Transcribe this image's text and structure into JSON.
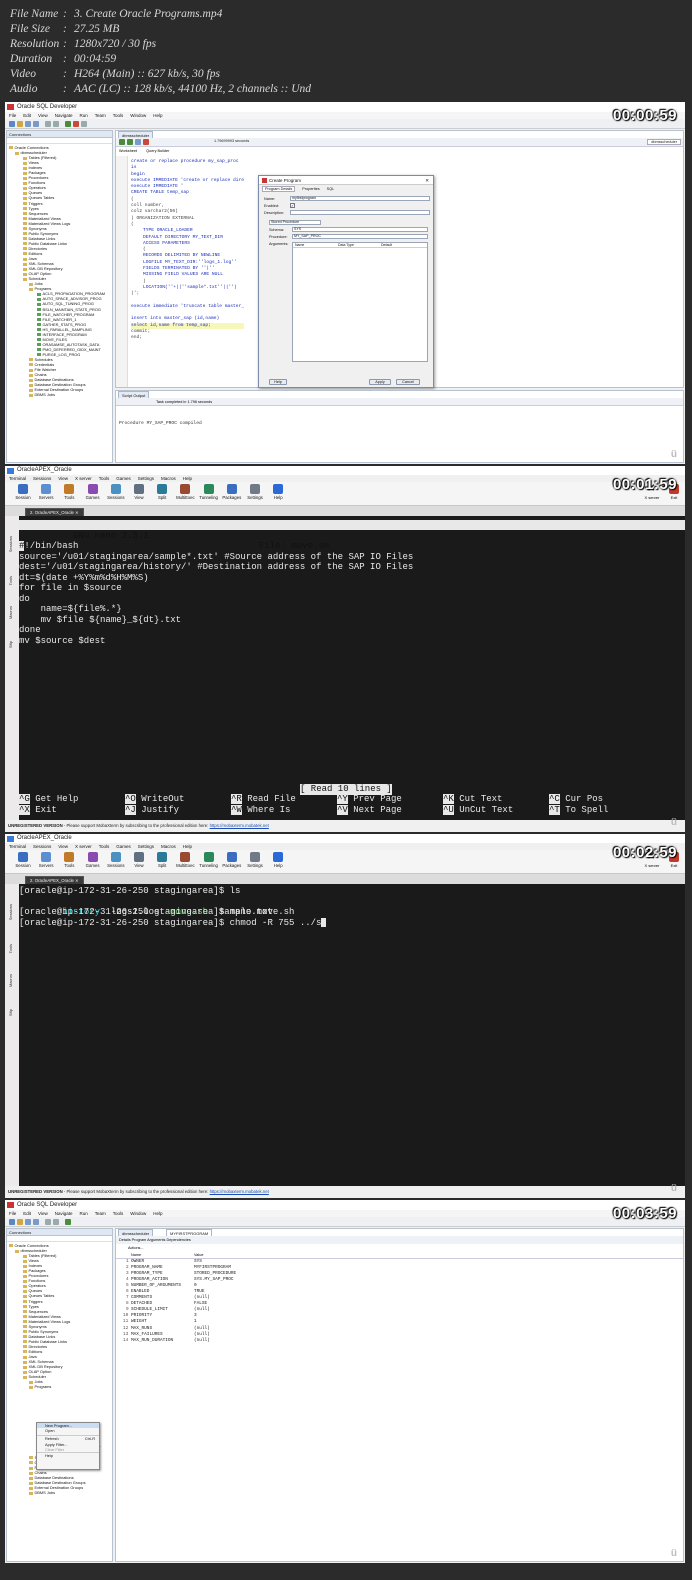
{
  "file_info": [
    {
      "key": "File Name",
      "value": "3. Create Oracle Programs.mp4"
    },
    {
      "key": "File Size",
      "value": "27.25 MB"
    },
    {
      "key": "Resolution",
      "value": "1280x720 / 30 fps"
    },
    {
      "key": "Duration",
      "value": "00:04:59"
    },
    {
      "key": "Video",
      "value": "H264 (Main) :: 627 kb/s, 30 fps"
    },
    {
      "key": "Audio",
      "value": "AAC (LC) :: 128 kb/s, 44100 Hz, 2 channels :: Und"
    }
  ],
  "frame1": {
    "timestamp": "00:00:59",
    "window_title": "Oracle SQL Developer",
    "menu": [
      "File",
      "Edit",
      "View",
      "Navigate",
      "Run",
      "Team",
      "Tools",
      "Window",
      "Help"
    ],
    "connections_title": "Connections",
    "editor_tab": "dbmsscheduler",
    "sub_tabs": [
      "Worksheet",
      "Query Builder"
    ],
    "exec_time": "1.79699993 seconds",
    "connection_select": "dbmsscheduler",
    "tree": [
      "Oracle Connections",
      "dbmsscheduler",
      "Tables (Filtered)",
      "Views",
      "Indexes",
      "Packages",
      "Procedures",
      "Functions",
      "Operators",
      "Queues",
      "Queues Tables",
      "Triggers",
      "Types",
      "Sequences",
      "Materialized Views",
      "Materialized Views Logs",
      "Synonyms",
      "Public Synonyms",
      "Database Links",
      "Public Database Links",
      "Directories",
      "Editions",
      "Java",
      "XML Schemas",
      "XML DB Repository",
      "OLAP Option",
      "Scheduler",
      "Jobs",
      "Programs",
      "ACLS_PROPAGATION_PROGRAM",
      "AUTO_SPACE_ADVISOR_PROG",
      "AUTO_SQL_TUNING_PROG",
      "BSLN_MAINTAIN_STATS_PROG",
      "FILE_WATCHER_PROGRAM",
      "FILE_WATCHER_1",
      "GATHER_STATS_PROG",
      "HS_PARALLEL_SAMPLING",
      "INTERFACE_PROGRAM",
      "MOVE_FILES",
      "ORASAMSE_AUTOTASK_DATA",
      "PMO_DEFERRED_GIDX_MAINT",
      "PURGE_LOG_PROG",
      "Schedules",
      "Credentials",
      "File Watcher",
      "Chains",
      "Database Destinations",
      "Database Destination Groups",
      "External Destination Groups",
      "DBMS Jobs"
    ],
    "code_lines": [
      "create or replace procedure my_sap_proc",
      "is",
      "begin",
      "execute IMMEDIATE 'create or replace dire",
      "execute IMMEDIATE '",
      "CREATE TABLE temp_sap",
      "(",
      "coll number,",
      "col2 varchar2(50)",
      ") ORGANIZATION EXTERNAL",
      "(",
      "TYPE ORACLE_LOADER",
      "DEFAULT DIRECTORY MY_TEXT_DIR",
      "ACCESS PARAMETERS",
      "(",
      "RECORDS DELIMITED BY NEWLINE",
      "LOGFILE MY_TEXT_DIR:''logs_1.log''",
      "FIELDS TERMINATED BY ''|''",
      "MISSING FIELD VALUES ARE NULL",
      ")",
      "LOCATION(''+||''sample*.txt''||'')",
      ")';",
      "",
      "execute immediate 'truncate table master_",
      "",
      "insert into master_sap (id,name)",
      "select id,name from temp_sap;",
      "commit;",
      "end;"
    ],
    "dialog": {
      "title": "Create Program",
      "tabs": [
        "Program Details",
        "Properties",
        "SQL"
      ],
      "name_label": "Name:",
      "name_value": "myfirstprogram",
      "enabled_label": "Enabled:",
      "description_label": "Description:",
      "type_value": "Stored Procedure",
      "schema_label": "Schema:",
      "schema_value": "SYS",
      "procedure_label": "Procedure:",
      "procedure_value": "MY_SAP_PROC",
      "arguments_label": "Arguments:",
      "arg_cols": [
        "Name",
        "Data Type",
        "Default"
      ],
      "help_button": "Help",
      "apply_button": "Apply",
      "cancel_button": "Cancel"
    },
    "output_tab": "Script Output",
    "output_status": "Task completed in 1.796 seconds",
    "output_text": "Procedure MY_SAP_PROC compiled"
  },
  "frame2": {
    "timestamp": "00:01:59",
    "window_title": "OracleAPEX_Oracle",
    "menu": [
      "Terminal",
      "Sessions",
      "View",
      "X server",
      "Tools",
      "Games",
      "Settings",
      "Macros",
      "Help"
    ],
    "toolbar": [
      "Session",
      "Servers",
      "Tools",
      "Games",
      "Sessions",
      "View",
      "Split",
      "MultiExec",
      "Tunneling",
      "Packages",
      "Settings",
      "Help"
    ],
    "xserver_label": "X server",
    "exit_label": "Exit",
    "tab_label": "2. OracleAPEX_Oracle",
    "side_labels": [
      "Sessions",
      "Tools",
      "Macros",
      "Sftp"
    ],
    "nano_version": "  GNU nano 2.3.1",
    "nano_file": "File: move.sh",
    "lines": [
      "#!/bin/bash",
      "source='/u01/stagingarea/sample*.txt' #Source address of the SAP IO Files",
      "dest='/u01/stagingarea/history/' #Destination address of the SAP IO Files",
      "dt=$(date +%Y%m%d%H%M%S)",
      "for file in $source",
      "do",
      "    name=${file%.*}",
      "    mv $file ${name}_${dt}.txt",
      "done",
      "mv $source $dest"
    ],
    "read_msg": "[ Read 10 lines ]",
    "keys1": [
      [
        "^G",
        "Get Help"
      ],
      [
        "^O",
        "WriteOut"
      ],
      [
        "^R",
        "Read File"
      ],
      [
        "^Y",
        "Prev Page"
      ],
      [
        "^K",
        "Cut Text"
      ],
      [
        "^C",
        "Cur Pos"
      ]
    ],
    "keys2": [
      [
        "^X",
        "Exit"
      ],
      [
        "^J",
        "Justify"
      ],
      [
        "^W",
        "Where Is"
      ],
      [
        "^V",
        "Next Page"
      ],
      [
        "^U",
        "UnCut Text"
      ],
      [
        "^T",
        "To Spell"
      ]
    ],
    "status": "UNREGISTERED VERSION",
    "status_msg": "  -  Please support MobaXterm by subscribing to the professional edition here:",
    "status_link": "https://mobaxterm.mobatek.net"
  },
  "frame3": {
    "timestamp": "00:02:59",
    "window_title": "OracleAPEX_Oracle",
    "tab_label": "2. OracleAPEX_Oracle",
    "line1": "[oracle@ip-172-31-26-250 stagingarea]$ ls",
    "ls_items": [
      "history",
      "logs1.log",
      "move.sh",
      "sample.txt"
    ],
    "line3": "[oracle@ip-172-31-26-250 stagingarea]$ nano move.sh",
    "line4": "[oracle@ip-172-31-26-250 stagingarea]$ chmod -R 755 ../s"
  },
  "frame4": {
    "timestamp": "00:03:59",
    "window_title": "Oracle SQL Developer",
    "tabs": [
      "dbmsscheduler",
      "MYFIRSTPROGRAM"
    ],
    "sub_tabs": "Details  Program Arguments  Dependencies",
    "actions": "Actions...",
    "col_name": "Name",
    "col_value": "Value",
    "props": [
      [
        "OWNER",
        "SYS"
      ],
      [
        "PROGRAM_NAME",
        "MYFIRSTPROGRAM"
      ],
      [
        "PROGRAM_TYPE",
        "STORED_PROCEDURE"
      ],
      [
        "PROGRAM_ACTION",
        "SYS.MY_SAP_PROC"
      ],
      [
        "NUMBER_OF_ARGUMENTS",
        "0"
      ],
      [
        "ENABLED",
        "TRUE"
      ],
      [
        "COMMENTS",
        "(null)"
      ],
      [
        "DETACHED",
        "FALSE"
      ],
      [
        "SCHEDULE_LIMIT",
        "(null)"
      ],
      [
        "PRIORITY",
        "3"
      ],
      [
        "WEIGHT",
        "1"
      ],
      [
        "MAX_RUNS",
        "(null)"
      ],
      [
        "MAX_FAILURES",
        "(null)"
      ],
      [
        "MAX_RUN_DURATION",
        "(null)"
      ]
    ],
    "tree": [
      "Oracle Connections",
      "dbmsscheduler",
      "Tables (Filtered)",
      "Views",
      "Indexes",
      "Packages",
      "Procedures",
      "Functions",
      "Operators",
      "Queues",
      "Queues Tables",
      "Triggers",
      "Types",
      "Sequences",
      "Materialized Views",
      "Materialized Views Logs",
      "Synonyms",
      "Public Synonyms",
      "Database Links",
      "Public Database Links",
      "Directories",
      "Editions",
      "Java",
      "XML Schemas",
      "XML DB Repository",
      "OLAP Option",
      "Scheduler",
      "Jobs",
      "Programs",
      "",
      "",
      "",
      "",
      "",
      "",
      "",
      "INTERFACE_PROGRAM",
      "MOVE_FILES",
      "MYFIRSTPROGRAM",
      "ORASAMSE_AUTOTASK_DATA",
      "PMO_DEFERRED_GIDX_MAINT",
      "PURGE_LOG_PROG",
      "Schedules",
      "Credentials",
      "File Watcher",
      "Chains",
      "Database Destinations",
      "Database Destination Groups",
      "External Destination Groups",
      "DBMS Jobs"
    ],
    "context_menu": [
      "New Program...",
      "Open",
      "Refresh",
      "Apply Filter...",
      "Clear Filter",
      "Help"
    ],
    "refresh_shortcut": "Ctrl-R"
  }
}
